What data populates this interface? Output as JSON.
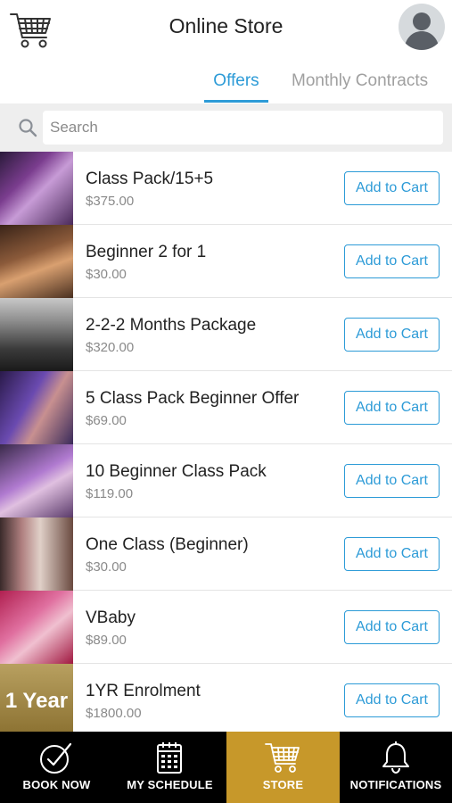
{
  "header": {
    "title": "Online Store",
    "cart_icon": "shopping-cart-icon",
    "avatar_icon": "user-avatar-icon"
  },
  "tabs": [
    {
      "label": "Offers",
      "active": true
    },
    {
      "label": "Monthly Contracts",
      "active": false
    }
  ],
  "search": {
    "placeholder": "Search",
    "value": "",
    "icon": "search-icon"
  },
  "items": [
    {
      "name": "Class Pack/15+5",
      "price": "$375.00",
      "button": "Add to Cart",
      "thumb_text": ""
    },
    {
      "name": "Beginner 2 for 1",
      "price": "$30.00",
      "button": "Add to Cart",
      "thumb_text": ""
    },
    {
      "name": "2-2-2 Months Package",
      "price": "$320.00",
      "button": "Add to Cart",
      "thumb_text": ""
    },
    {
      "name": "5 Class Pack Beginner Offer",
      "price": "$69.00",
      "button": "Add to Cart",
      "thumb_text": ""
    },
    {
      "name": "10 Beginner Class Pack",
      "price": "$119.00",
      "button": "Add to Cart",
      "thumb_text": ""
    },
    {
      "name": "One Class (Beginner)",
      "price": "$30.00",
      "button": "Add to Cart",
      "thumb_text": ""
    },
    {
      "name": "VBaby",
      "price": "$89.00",
      "button": "Add to Cart",
      "thumb_text": ""
    },
    {
      "name": "1YR Enrolment",
      "price": "$1800.00",
      "button": "Add to Cart",
      "thumb_text": "1 Year"
    }
  ],
  "tabbar": [
    {
      "label": "BOOK NOW",
      "icon": "check-circle-icon",
      "active": false
    },
    {
      "label": "MY SCHEDULE",
      "icon": "calendar-icon",
      "active": false
    },
    {
      "label": "STORE",
      "icon": "shopping-cart-icon",
      "active": true
    },
    {
      "label": "NOTIFICATIONS",
      "icon": "bell-icon",
      "active": false
    }
  ],
  "colors": {
    "accent": "#2d9bd7",
    "store_active": "#c7982a",
    "tabbar_bg": "#000000"
  }
}
